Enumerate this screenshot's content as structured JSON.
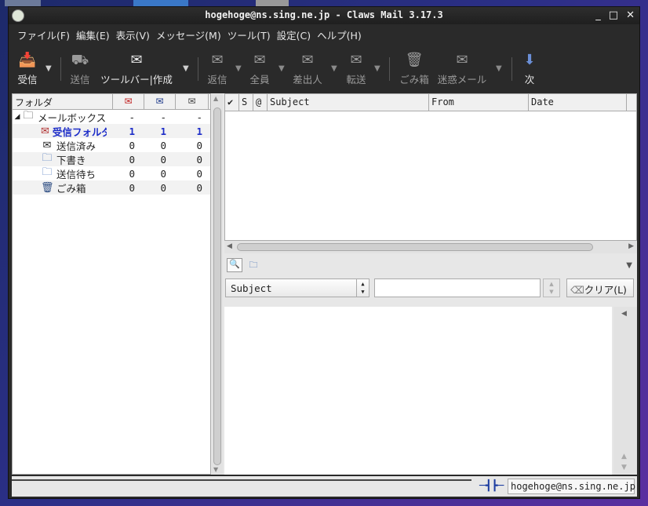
{
  "window": {
    "title": "hogehoge@ns.sing.ne.jp - Claws Mail 3.17.3"
  },
  "menubar": [
    "ファイル(F)",
    "編集(E)",
    "表示(V)",
    "メッセージ(M)",
    "ツール(T)",
    "設定(C)",
    "ヘルプ(H)"
  ],
  "toolbar": {
    "receive": "受信",
    "send": "送信",
    "compose": "ツールバー|作成",
    "reply": "返信",
    "reply_all": "全員",
    "reply_sender": "差出人",
    "forward": "転送",
    "trash": "ごみ箱",
    "spam": "迷惑メール",
    "next": "次"
  },
  "folder_pane": {
    "header": "フォルダ",
    "mailbox": {
      "name": "メールボックス",
      "unread": "-",
      "new": "-",
      "total": "-"
    },
    "folders": [
      {
        "name": "受信フォルダ",
        "unread": "1",
        "new": "1",
        "total": "1",
        "icon": "inbox-icon"
      },
      {
        "name": "送信済み",
        "unread": "0",
        "new": "0",
        "total": "0",
        "icon": "sent-icon"
      },
      {
        "name": "下書き",
        "unread": "0",
        "new": "0",
        "total": "0",
        "icon": "drafts-icon"
      },
      {
        "name": "送信待ち",
        "unread": "0",
        "new": "0",
        "total": "0",
        "icon": "queue-icon"
      },
      {
        "name": "ごみ箱",
        "unread": "0",
        "new": "0",
        "total": "0",
        "icon": "trash-icon"
      }
    ]
  },
  "message_list": {
    "columns": [
      "✔",
      "S",
      "@",
      "Subject",
      "From",
      "Date"
    ]
  },
  "quick_search": {
    "field": "Subject",
    "value": "",
    "clear_label": "クリア(L)"
  },
  "status": {
    "account": "hogehoge@ns.sing.ne.jp"
  },
  "colors": {
    "accent_blue": "#1d2dc8",
    "window_dark": "#2a2a2a"
  }
}
